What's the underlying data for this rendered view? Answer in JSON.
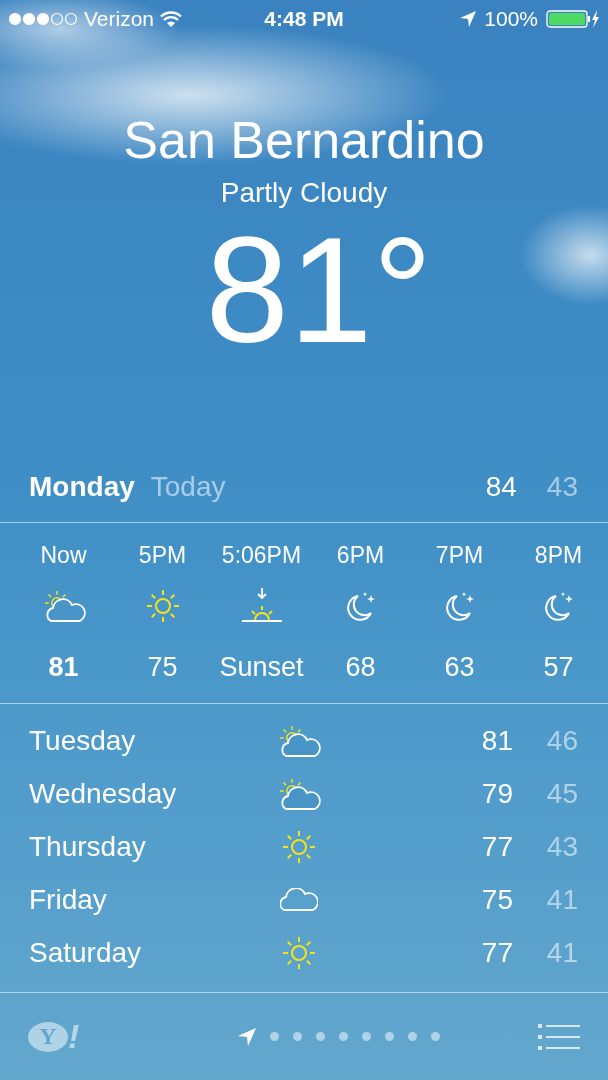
{
  "status_bar": {
    "carrier": "Verizon",
    "time": "4:48 PM",
    "battery": "100%"
  },
  "location": {
    "city": "San Bernardino",
    "condition": "Partly Cloudy",
    "temperature": "81°"
  },
  "today": {
    "day": "Monday",
    "label": "Today",
    "high": "84",
    "low": "43"
  },
  "hourly": [
    {
      "time": "Now",
      "kind": "partly-cloudy",
      "temp": "81",
      "selected": true
    },
    {
      "time": "5PM",
      "kind": "sunny",
      "temp": "75",
      "selected": false
    },
    {
      "time": "5:06PM",
      "kind": "sunset",
      "temp": "Sunset",
      "selected": false
    },
    {
      "time": "6PM",
      "kind": "moon",
      "temp": "68",
      "selected": false
    },
    {
      "time": "7PM",
      "kind": "moon",
      "temp": "63",
      "selected": false
    },
    {
      "time": "8PM",
      "kind": "moon",
      "temp": "57",
      "selected": false
    }
  ],
  "daily": [
    {
      "day": "Tuesday",
      "kind": "partly-cloudy",
      "high": "81",
      "low": "46"
    },
    {
      "day": "Wednesday",
      "kind": "partly-cloudy",
      "high": "79",
      "low": "45"
    },
    {
      "day": "Thursday",
      "kind": "sunny",
      "high": "77",
      "low": "43"
    },
    {
      "day": "Friday",
      "kind": "cloudy",
      "high": "75",
      "low": "41"
    },
    {
      "day": "Saturday",
      "kind": "sunny",
      "high": "77",
      "low": "41"
    }
  ],
  "footer": {
    "logo": {
      "letter": "Y",
      "mark": "!"
    },
    "pages": [
      {
        "kind": "location",
        "selected": true
      },
      {
        "kind": "dot",
        "selected": false
      },
      {
        "kind": "dot",
        "selected": false
      },
      {
        "kind": "dot",
        "selected": false
      },
      {
        "kind": "dot",
        "selected": false
      },
      {
        "kind": "dot",
        "selected": false
      },
      {
        "kind": "dot",
        "selected": false
      },
      {
        "kind": "dot",
        "selected": false
      },
      {
        "kind": "dot",
        "selected": false
      }
    ]
  }
}
